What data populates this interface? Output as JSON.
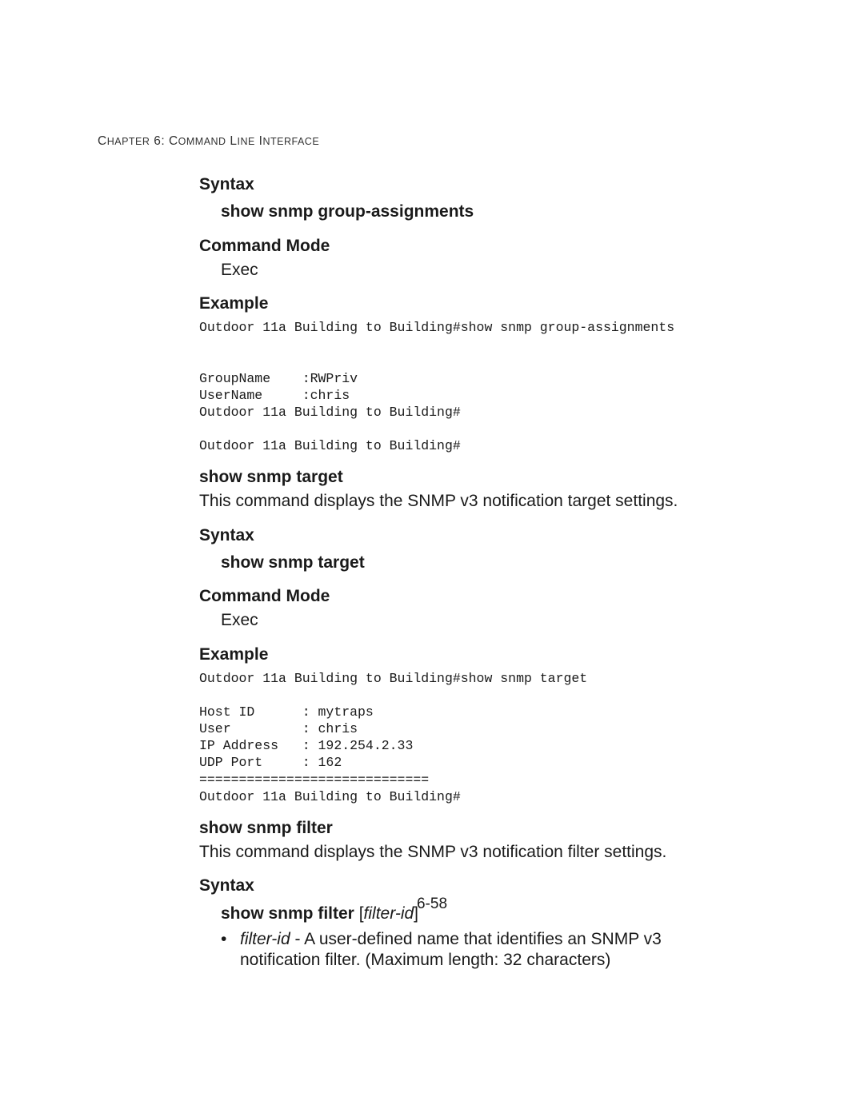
{
  "header": {
    "chapter_word": "C",
    "chapter_rest": "HAPTER",
    "chapter_num": " 6: C",
    "chapter_rest2": "OMMAND",
    "line_word": " L",
    "line_rest": "INE",
    "iface_word": " I",
    "iface_rest": "NTERFACE"
  },
  "s1": {
    "syntax": "Syntax",
    "cmd": "show snmp group-assignments",
    "mode_h": "Command Mode",
    "mode_v": "Exec",
    "ex_h": "Example",
    "ex_code": "Outdoor 11a Building to Building#show snmp group-assignments\n\n\nGroupName    :RWPriv\nUserName     :chris\nOutdoor 11a Building to Building#\n\nOutdoor 11a Building to Building#"
  },
  "s2": {
    "title": "show snmp target",
    "desc": "This command displays the SNMP v3 notification target settings.",
    "syntax": "Syntax",
    "cmd": "show snmp target",
    "mode_h": "Command Mode",
    "mode_v": "Exec",
    "ex_h": "Example",
    "ex_code": "Outdoor 11a Building to Building#show snmp target\n\nHost ID      : mytraps\nUser         : chris\nIP Address   : 192.254.2.33\nUDP Port     : 162\n=============================\nOutdoor 11a Building to Building#"
  },
  "s3": {
    "title": "show snmp filter",
    "desc": "This command displays the SNMP v3 notification filter settings.",
    "syntax": "Syntax",
    "cmd_bold": "show snmp filter ",
    "cmd_open": "[",
    "cmd_param": "filter-id",
    "cmd_close": "]",
    "bullet_param": "filter-id",
    "bullet_rest": " - A user-defined name that identifies an SNMP v3 notification filter. (Maximum length: 32 characters)"
  },
  "pagenum": "6-58"
}
